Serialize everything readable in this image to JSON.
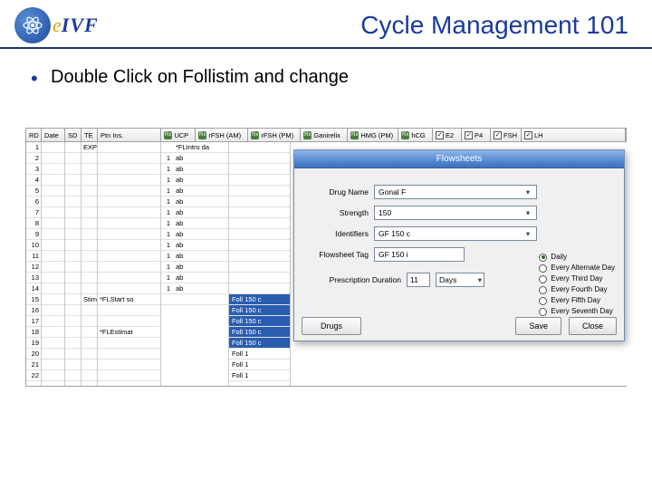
{
  "header": {
    "logo_e": "e",
    "logo_ivf": "IVF",
    "title": "Cycle Management 101"
  },
  "bullet": "Double Click on Follistim and change",
  "columns": {
    "rd": "RD",
    "date": "Date",
    "sd": "SD",
    "te": "TE",
    "ptn": "Ptn Ins.",
    "ucp": "UCP",
    "rfsh_am": "rFSH (AM)",
    "rfsh_pm": "rFSH (PM)",
    "ganirelix": "Ganirelix",
    "hmg_pm": "HMG (PM)",
    "hcg": "hCG",
    "e2": "E2",
    "p4": "P4",
    "fsh": "FSH",
    "lh": "LH"
  },
  "rd_values": [
    "1",
    "2",
    "3",
    "4",
    "5",
    "6",
    "7",
    "8",
    "9",
    "10",
    "11",
    "12",
    "13",
    "14",
    "15",
    "16",
    "17",
    "18",
    "19",
    "20",
    "21",
    "22"
  ],
  "ptn_events": {
    "r1": "EXP",
    "r15": "Stim Start",
    "r18": "",
    "r15b": "*FLStart so",
    "r18b": "*FLEstimat"
  },
  "mid_num": "1",
  "mid_txt": "ab",
  "med_list_sel": "Foll 150 c",
  "med_list_item": "Foll 1",
  "dialog": {
    "title": "Flowsheets",
    "drug_name_lbl": "Drug Name",
    "drug_name_val": "Gonal F",
    "strength_lbl": "Strength",
    "strength_val": "150",
    "identifiers_lbl": "Identifiers",
    "identifiers_val": "GF 150 c",
    "flowsheet_tag_lbl": "Flowsheet Tag",
    "flowsheet_tag_val": "GF  150 i",
    "presc_dur_lbl": "Prescription Duration",
    "presc_dur_num": "11",
    "presc_dur_unit": "Days",
    "radios": {
      "daily": "Daily",
      "alt": "Every Alternate Day",
      "third": "Every Third Day",
      "fourth": "Every Fourth Day",
      "fifth": "Every Fifth Day",
      "seventh": "Every Seventh Day"
    },
    "btn_drugs": "Drugs",
    "btn_save": "Save",
    "btn_close": "Close"
  }
}
